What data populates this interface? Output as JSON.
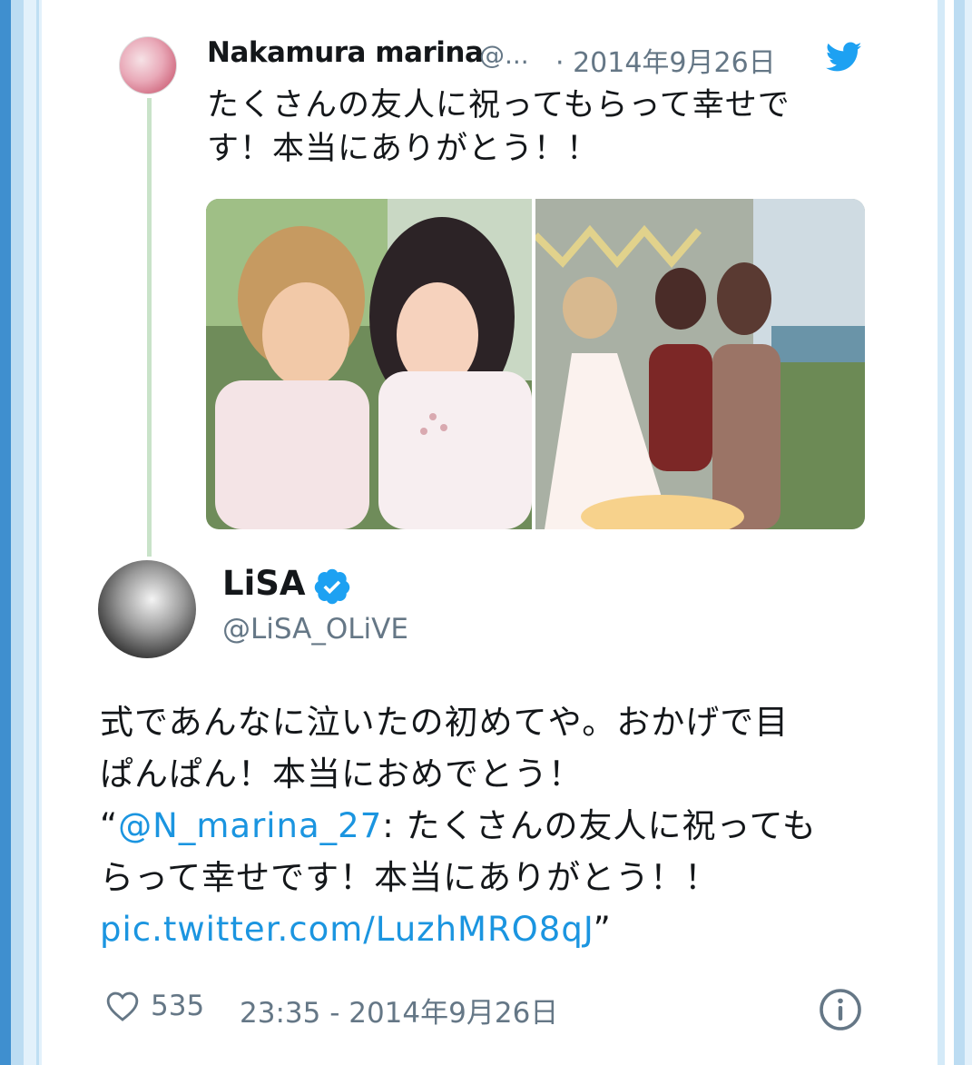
{
  "parent_tweet": {
    "display_name": "Nakamura marina",
    "handle": "@...",
    "date": "· 2014年9月26日",
    "text": "たくさんの友人に祝ってもらって幸せです！本当にありがとう！！"
  },
  "main_tweet": {
    "display_name": "LiSA",
    "handle": "@LiSA_OLiVE",
    "line1": "式であんなに泣いたの初めてや。おかげで目",
    "line2": "ぱんぱん！本当におめでとう！",
    "quote_open": "“",
    "mention": "@N_marina_27",
    "quote_text_1": ": たくさんの友人に祝っても",
    "quote_text_2": "らって幸せです！本当にありがとう！！",
    "pic_link": "pic.twitter.com/LuzhMRO8qJ",
    "quote_close": "”",
    "likes": "535",
    "timestamp": "23:35 - 2014年9月26日"
  },
  "icons": {
    "brand": "twitter-bird-icon",
    "verified": "verified-badge-icon",
    "like": "heart-icon",
    "info": "info-icon"
  },
  "colors": {
    "link": "#1b95e0",
    "twitter_blue": "#1da1f2",
    "secondary_text": "#657786"
  }
}
